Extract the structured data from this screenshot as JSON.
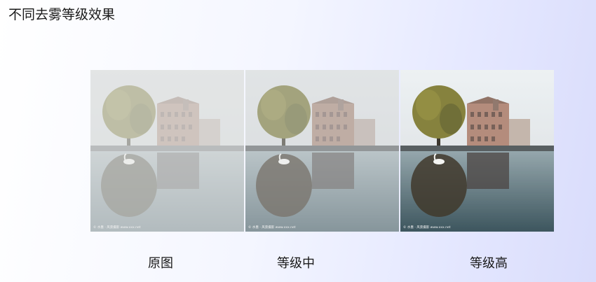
{
  "slide": {
    "title": "不同去雾等级效果"
  },
  "panels": [
    {
      "caption": "原图",
      "haze_level": 0.62,
      "watermark": "© 水墨 · 风景摄影 www.xxx.net"
    },
    {
      "caption": "等级中",
      "haze_level": 0.38,
      "watermark": "© 水墨 · 风景摄影 www.xxx.net"
    },
    {
      "caption": "等级高",
      "haze_level": 0.08,
      "watermark": "© 水墨 · 风景摄影 www.xxx.net"
    }
  ],
  "colors": {
    "sky_hazy": "#dcdfe0",
    "sky_clear": "#eef2f4",
    "water": "#405b63",
    "tree_foliage": "#7b7a3a",
    "building": "#a88a7a",
    "swan": "#f4f4f0",
    "text": "#1a1a1a"
  }
}
